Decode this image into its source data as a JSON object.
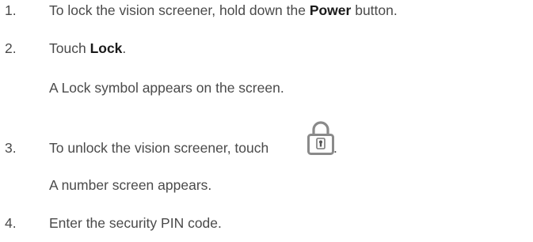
{
  "steps": [
    {
      "number": "1.",
      "before": "To lock the vision screener, hold down the ",
      "bold": "Power",
      "after": " button."
    },
    {
      "number": "2.",
      "before": "Touch ",
      "bold": "Lock",
      "after": ".",
      "note": "A Lock symbol appears on the screen."
    },
    {
      "number": "3.",
      "before": "To unlock the vision screener, touch ",
      "after": ".",
      "icon": "lock-icon",
      "note": "A number screen appears."
    },
    {
      "number": "4.",
      "before": "Enter the security PIN code."
    }
  ]
}
